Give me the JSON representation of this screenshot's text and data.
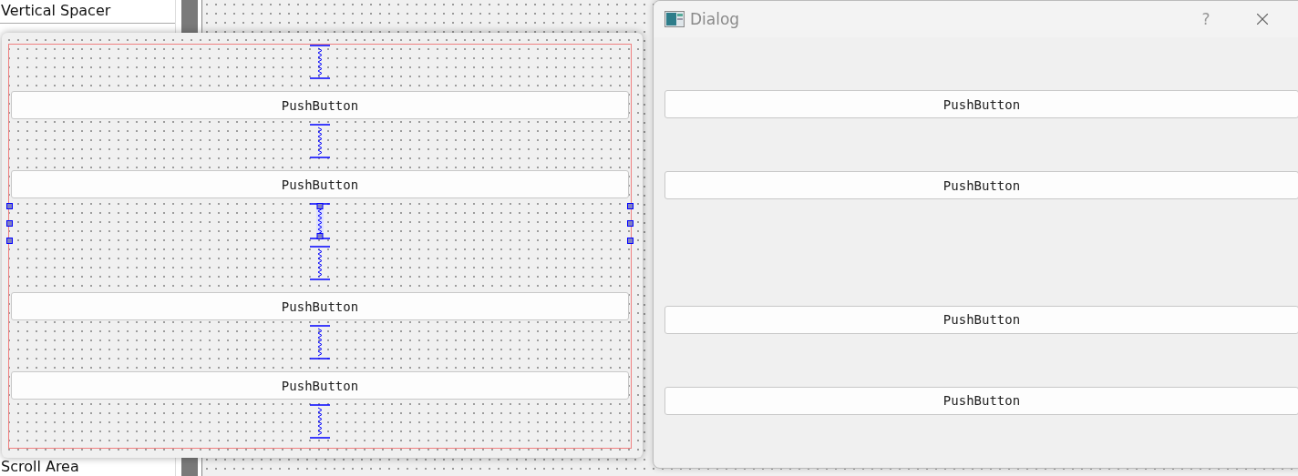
{
  "widget_box": {
    "items": [
      {
        "label": "Vertical Spacer"
      },
      {
        "label": "Scroll Area"
      }
    ]
  },
  "form_preview": {
    "items": [
      {
        "kind": "spacer",
        "selected": false
      },
      {
        "kind": "button",
        "label": "PushButton"
      },
      {
        "kind": "spacer",
        "selected": false
      },
      {
        "kind": "button",
        "label": "PushButton"
      },
      {
        "kind": "spacer",
        "selected": true
      },
      {
        "kind": "spacer",
        "selected": false
      },
      {
        "kind": "button",
        "label": "PushButton"
      },
      {
        "kind": "spacer",
        "selected": false
      },
      {
        "kind": "button",
        "label": "PushButton"
      },
      {
        "kind": "spacer",
        "selected": false
      }
    ]
  },
  "dialog": {
    "title": "Dialog",
    "help": "?",
    "items": [
      {
        "kind": "spacer"
      },
      {
        "kind": "button",
        "label": "PushButton"
      },
      {
        "kind": "spacer"
      },
      {
        "kind": "button",
        "label": "PushButton"
      },
      {
        "kind": "spacer"
      },
      {
        "kind": "spacer"
      },
      {
        "kind": "button",
        "label": "PushButton"
      },
      {
        "kind": "spacer"
      },
      {
        "kind": "button",
        "label": "PushButton"
      },
      {
        "kind": "spacer"
      }
    ]
  }
}
